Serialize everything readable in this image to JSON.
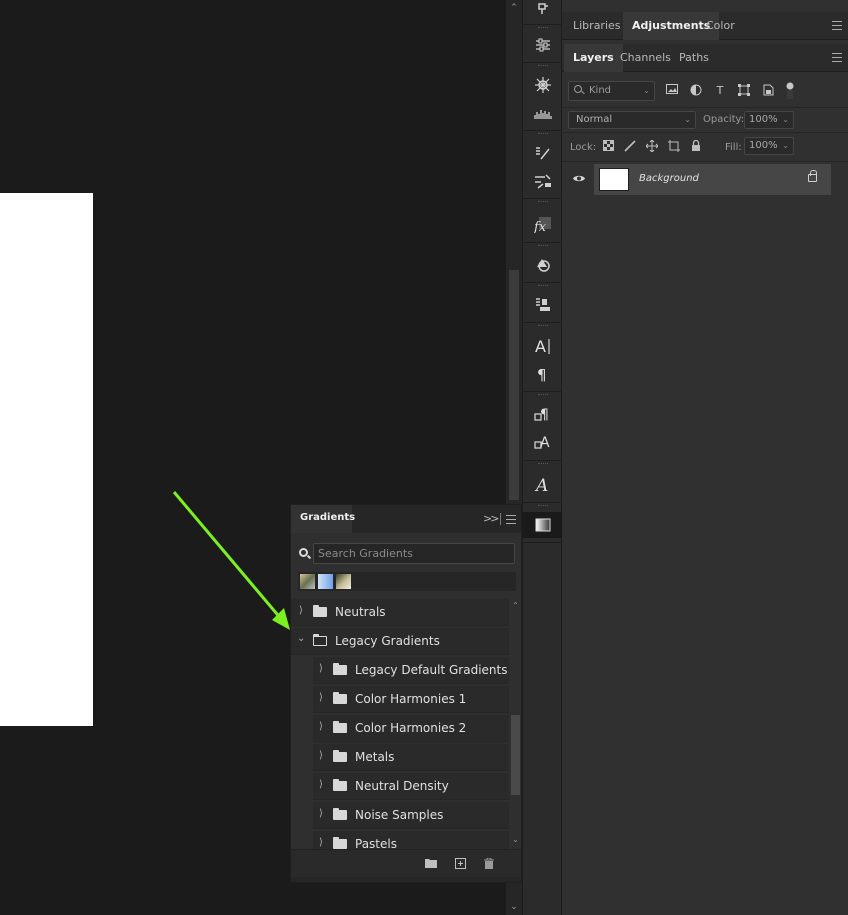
{
  "top_tabs": [
    {
      "label": "Libraries",
      "selected": false
    },
    {
      "label": "Adjustments",
      "selected": true
    },
    {
      "label": "Color",
      "selected": false
    }
  ],
  "layer_tabs": [
    {
      "label": "Layers",
      "selected": true
    },
    {
      "label": "Channels",
      "selected": false
    },
    {
      "label": "Paths",
      "selected": false
    }
  ],
  "layers_panel": {
    "kind_filter": "Kind",
    "blend_mode": "Normal",
    "opacity_label": "Opacity:",
    "opacity_value": "100%",
    "lock_label": "Lock:",
    "fill_label": "Fill:",
    "fill_value": "100%",
    "layers": [
      {
        "name": "Background",
        "visible": true,
        "locked": true
      }
    ]
  },
  "tools": [
    {
      "icon": "history-brush-icon"
    },
    {
      "icon": "adjustments-sliders-icon"
    },
    {
      "icon": "compass-wheel-icon"
    },
    {
      "icon": "histogram-icon"
    },
    {
      "icon": "brush-presets-icon"
    },
    {
      "icon": "brush-settings-icon"
    },
    {
      "icon": "fx-styles-icon"
    },
    {
      "icon": "shapes-icon"
    },
    {
      "icon": "clone-source-icon"
    },
    {
      "icon": "character-icon"
    },
    {
      "icon": "paragraph-icon"
    },
    {
      "icon": "paragraph-styles-icon"
    },
    {
      "icon": "character-styles-icon"
    },
    {
      "icon": "glyphs-icon"
    },
    {
      "icon": "gradients-icon"
    }
  ],
  "gradients_panel": {
    "title": "Gradients",
    "search_placeholder": "Search Gradients",
    "recent_swatches": [
      "#8c8a6a",
      "#a8c8ee",
      "#7a7a4a"
    ],
    "items": [
      {
        "label": "Neutrals",
        "level": 0,
        "expanded": false
      },
      {
        "label": "Legacy Gradients",
        "level": 0,
        "expanded": true
      },
      {
        "label": "Legacy Default Gradients",
        "level": 1,
        "expanded": false
      },
      {
        "label": "Color Harmonies 1",
        "level": 1,
        "expanded": false
      },
      {
        "label": "Color Harmonies 2",
        "level": 1,
        "expanded": false
      },
      {
        "label": "Metals",
        "level": 1,
        "expanded": false
      },
      {
        "label": "Neutral Density",
        "level": 1,
        "expanded": false
      },
      {
        "label": "Noise Samples",
        "level": 1,
        "expanded": false
      },
      {
        "label": "Pastels",
        "level": 1,
        "expanded": false
      }
    ]
  },
  "annotation": {
    "color": "#7cf020"
  }
}
